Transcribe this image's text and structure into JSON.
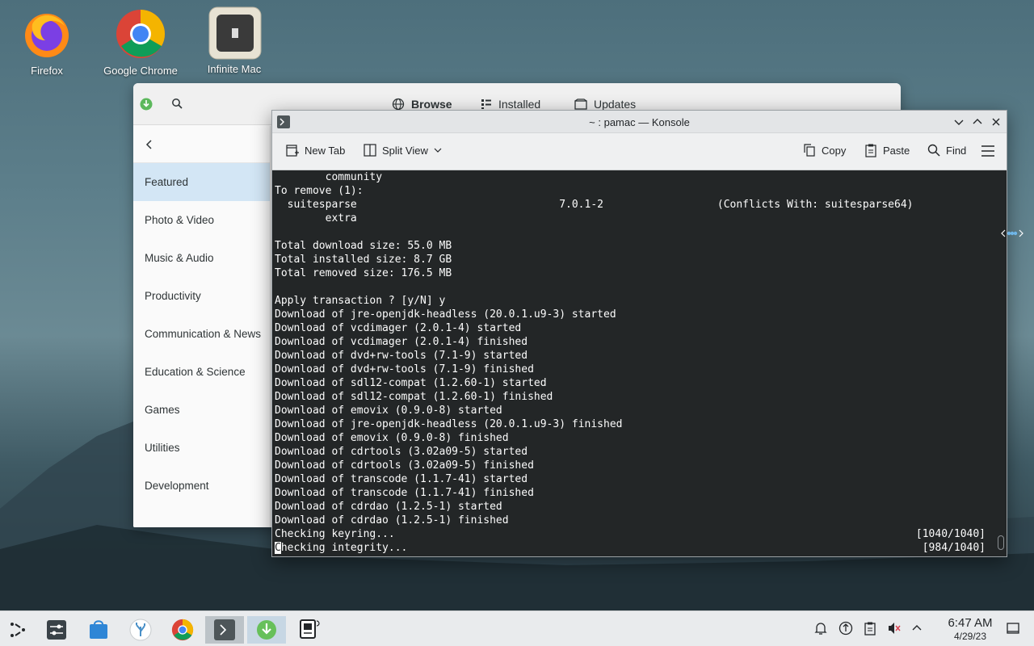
{
  "desktop": {
    "icons": [
      {
        "label": "Firefox"
      },
      {
        "label": "Google Chrome"
      },
      {
        "label": "Infinite Mac"
      }
    ]
  },
  "pamac": {
    "tabs": [
      {
        "label": "Browse"
      },
      {
        "label": "Installed"
      },
      {
        "label": "Updates"
      }
    ],
    "categories": [
      "Featured",
      "Photo & Video",
      "Music & Audio",
      "Productivity",
      "Communication & News",
      "Education & Science",
      "Games",
      "Utilities",
      "Development"
    ],
    "active_category": "Featured"
  },
  "konsole": {
    "title": "~ : pamac — Konsole",
    "toolbar": {
      "new_tab": "New Tab",
      "split_view": "Split View",
      "copy": "Copy",
      "paste": "Paste",
      "find": "Find"
    },
    "lines": [
      {
        "text": "        community",
        "right": ""
      },
      {
        "text": "To remove (1):",
        "right": ""
      },
      {
        "text": "  suitesparse                                7.0.1-2                  (Conflicts With: suitesparse64)",
        "right": ""
      },
      {
        "text": "        extra",
        "right": ""
      },
      {
        "text": "",
        "right": ""
      },
      {
        "text": "Total download size: 55.0 MB",
        "right": ""
      },
      {
        "text": "Total installed size: 8.7 GB",
        "right": ""
      },
      {
        "text": "Total removed size: 176.5 MB",
        "right": ""
      },
      {
        "text": "",
        "right": ""
      },
      {
        "text": "Apply transaction ? [y/N] y",
        "right": ""
      },
      {
        "text": "Download of jre-openjdk-headless (20.0.1.u9-3) started",
        "right": ""
      },
      {
        "text": "Download of vcdimager (2.0.1-4) started",
        "right": ""
      },
      {
        "text": "Download of vcdimager (2.0.1-4) finished",
        "right": ""
      },
      {
        "text": "Download of dvd+rw-tools (7.1-9) started",
        "right": ""
      },
      {
        "text": "Download of dvd+rw-tools (7.1-9) finished",
        "right": ""
      },
      {
        "text": "Download of sdl12-compat (1.2.60-1) started",
        "right": ""
      },
      {
        "text": "Download of sdl12-compat (1.2.60-1) finished",
        "right": ""
      },
      {
        "text": "Download of emovix (0.9.0-8) started",
        "right": ""
      },
      {
        "text": "Download of jre-openjdk-headless (20.0.1.u9-3) finished",
        "right": ""
      },
      {
        "text": "Download of emovix (0.9.0-8) finished",
        "right": ""
      },
      {
        "text": "Download of cdrtools (3.02a09-5) started",
        "right": ""
      },
      {
        "text": "Download of cdrtools (3.02a09-5) finished",
        "right": ""
      },
      {
        "text": "Download of transcode (1.1.7-41) started",
        "right": ""
      },
      {
        "text": "Download of transcode (1.1.7-41) finished",
        "right": ""
      },
      {
        "text": "Download of cdrdao (1.2.5-1) started",
        "right": ""
      },
      {
        "text": "Download of cdrdao (1.2.5-1) finished",
        "right": ""
      },
      {
        "text": "Checking keyring...",
        "right": "[1040/1040]"
      }
    ],
    "last_line": {
      "cursor_char": "C",
      "text": "hecking integrity...",
      "right": "[984/1040]"
    }
  },
  "taskbar": {
    "time": "6:47 AM",
    "date": "4/29/23"
  }
}
